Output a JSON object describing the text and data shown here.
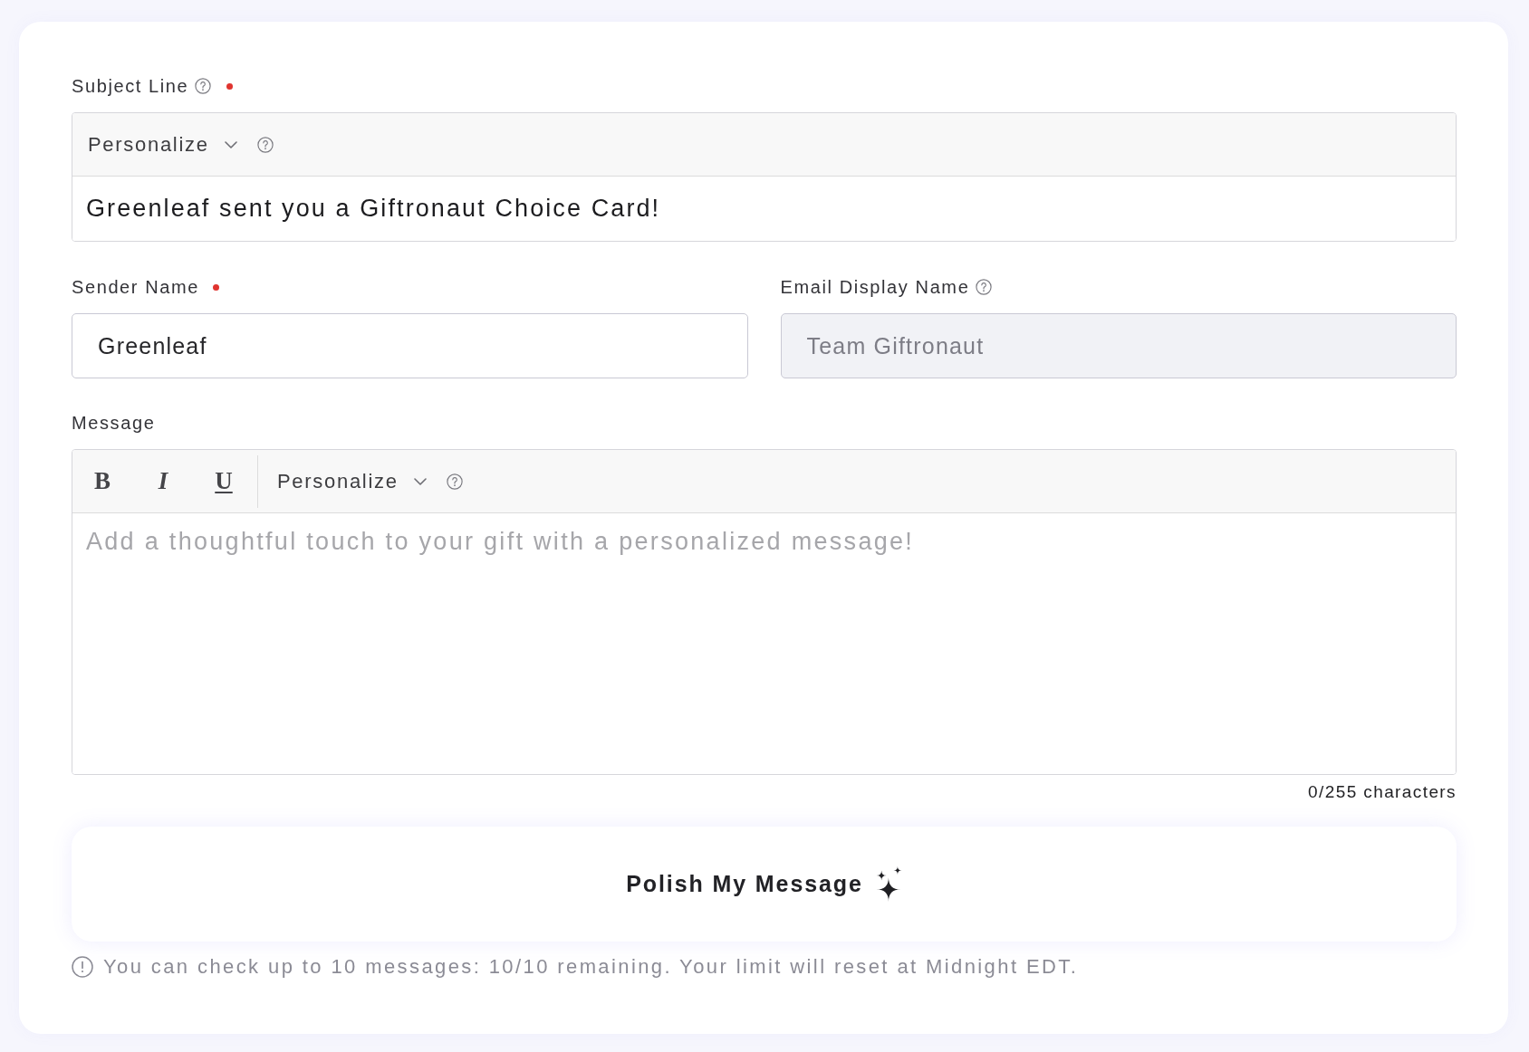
{
  "subject_line": {
    "label": "Subject Line",
    "help": true,
    "required": true,
    "personalize": "Personalize",
    "value": "Greenleaf sent you a Giftronaut Choice Card!"
  },
  "sender_name": {
    "label": "Sender Name",
    "help": false,
    "required": true,
    "disabled": false,
    "value": "Greenleaf"
  },
  "email_display_name": {
    "label": "Email Display Name",
    "help": true,
    "required": false,
    "disabled": true,
    "placeholder": "Team Giftronaut"
  },
  "message": {
    "label": "Message",
    "help": false,
    "required": false,
    "format_buttons": [
      {
        "kind": "bold",
        "label": "B"
      },
      {
        "kind": "italic",
        "label": "I"
      },
      {
        "kind": "underline",
        "label": "U"
      }
    ],
    "personalize": "Personalize",
    "placeholder": "Add a thoughtful touch to your gift with a personalized message!",
    "character_count": "0/255 characters"
  },
  "polish_button": {
    "label": "Polish My Message"
  },
  "limit_note": "You can check up to 10 messages: 10/10 remaining. Your limit will reset at Midnight EDT."
}
